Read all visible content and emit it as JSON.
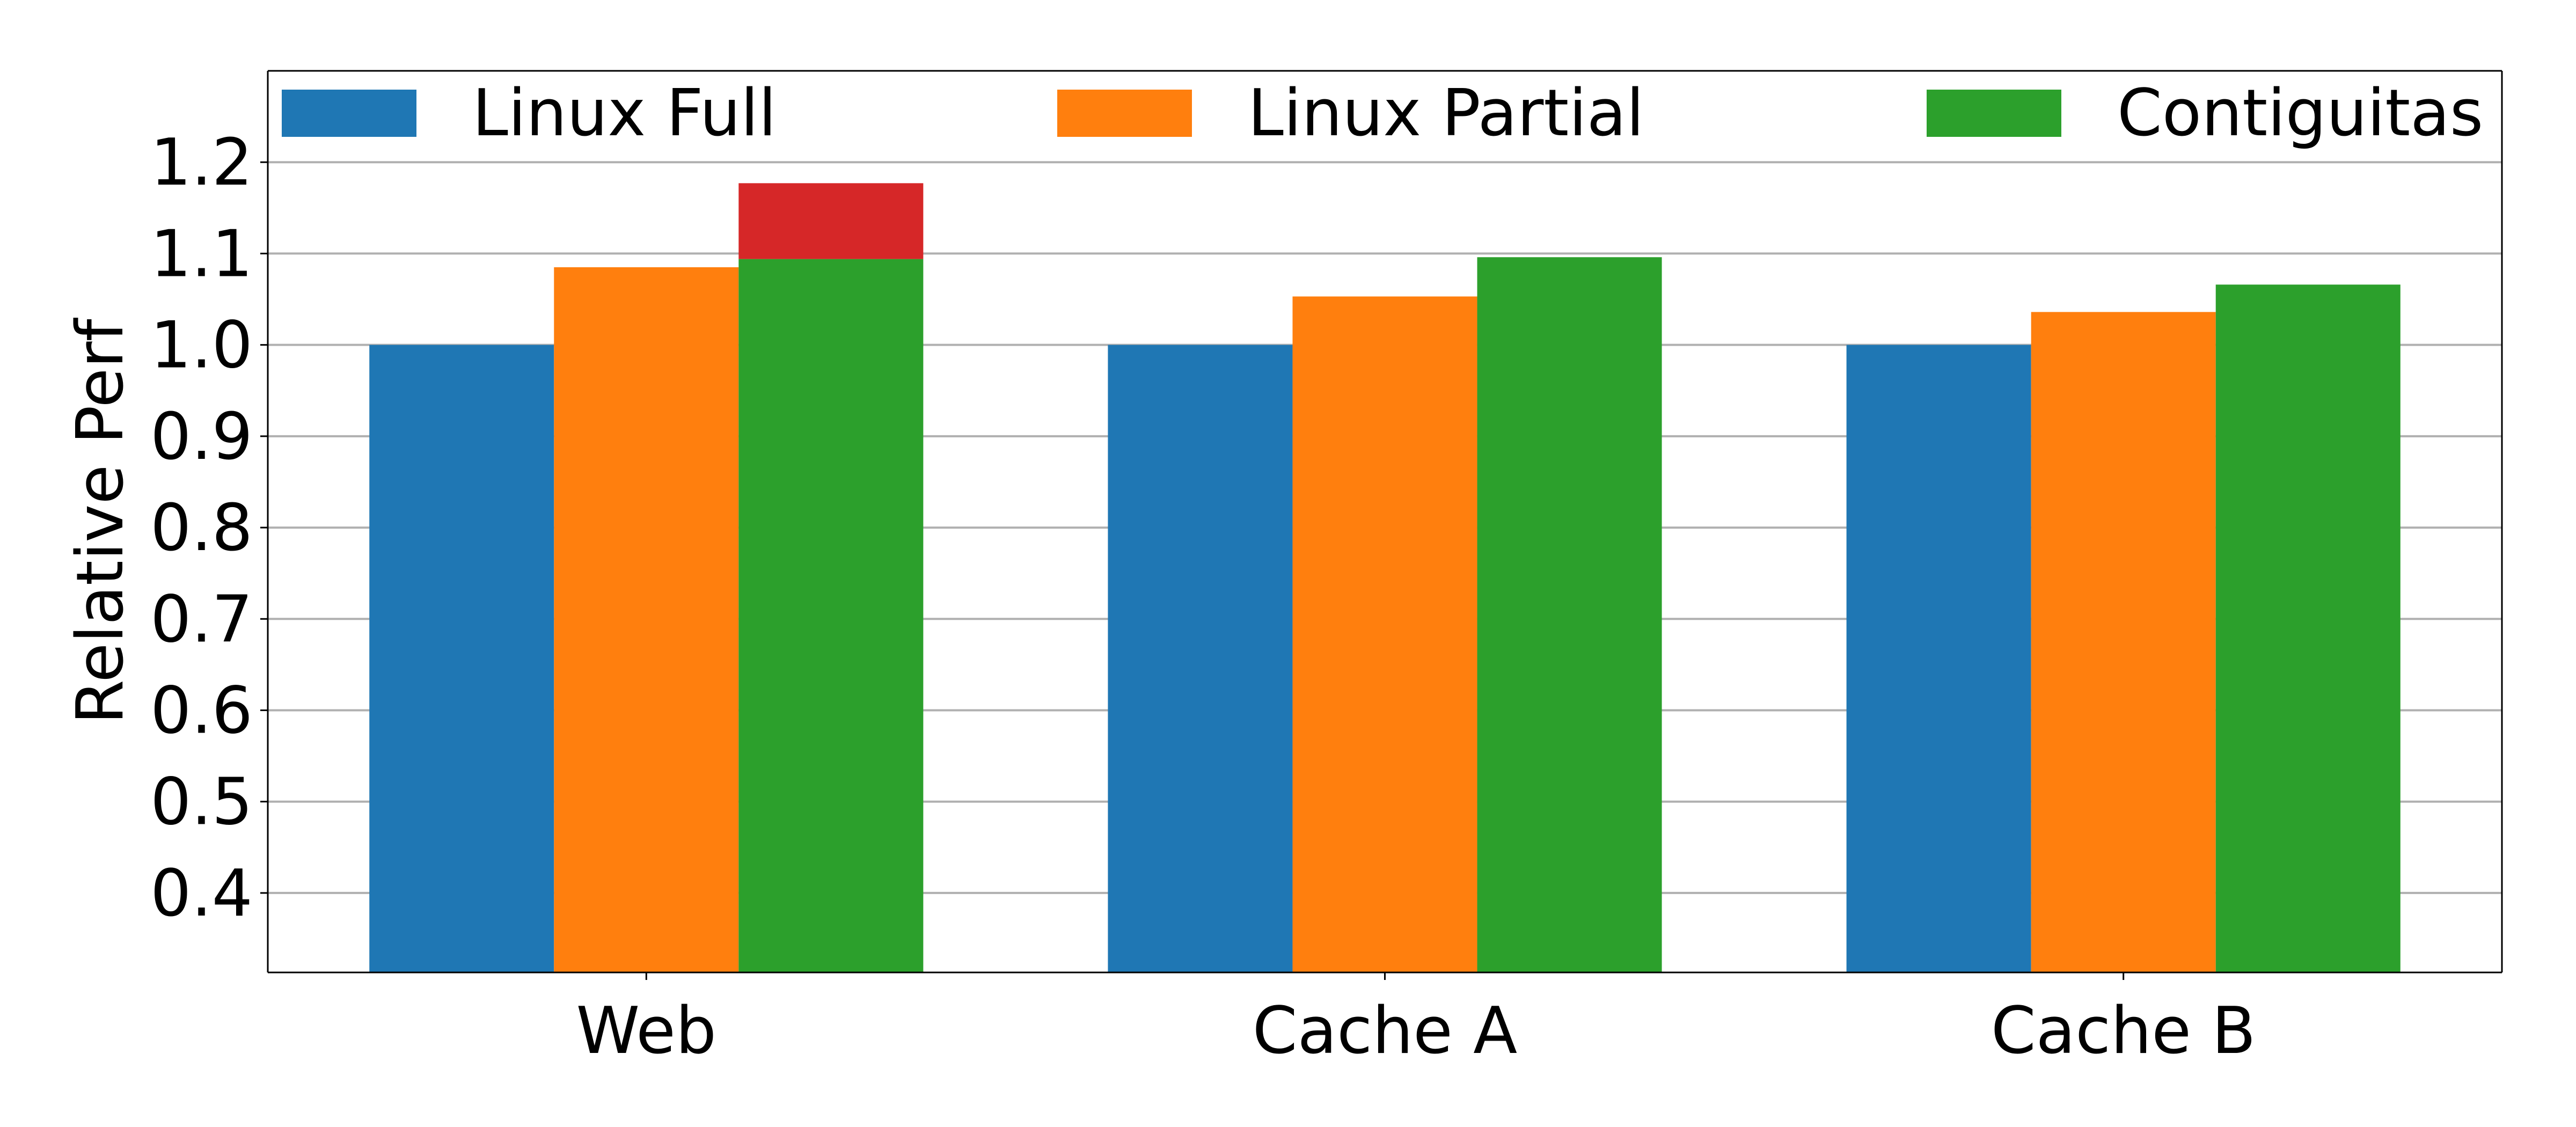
{
  "chart_data": {
    "type": "bar",
    "title": "",
    "xlabel": "",
    "ylabel": "Relative Perf",
    "categories": [
      "Web",
      "Cache A",
      "Cache B"
    ],
    "series": [
      {
        "name": "Linux Full",
        "color": "#1f77b4",
        "values": [
          1.0,
          1.0,
          1.0
        ]
      },
      {
        "name": "Linux Partial",
        "color": "#ff7f0e",
        "values": [
          1.085,
          1.053,
          1.036
        ]
      },
      {
        "name": "Contiguitas",
        "color": "#2ca02c",
        "values": [
          1.094,
          1.096,
          1.066
        ]
      }
    ],
    "stacked_extra": [
      {
        "category": "Web",
        "series": "Contiguitas",
        "color": "#d62728",
        "bottom": 1.094,
        "top": 1.177
      }
    ],
    "ylim": [
      0.313,
      1.3
    ],
    "yticks": [
      0.4,
      0.5,
      0.6,
      0.7,
      0.8,
      0.9,
      1.0,
      1.1,
      1.2
    ],
    "ytick_labels": [
      "0.4",
      "0.5",
      "0.6",
      "0.7",
      "0.8",
      "0.9",
      "1.0",
      "1.1",
      "1.2"
    ],
    "grid": "y",
    "legend_placement": "top (inside, 3 columns, no frame)",
    "legend": [
      "Linux Full",
      "Linux Partial",
      "Contiguitas"
    ]
  }
}
